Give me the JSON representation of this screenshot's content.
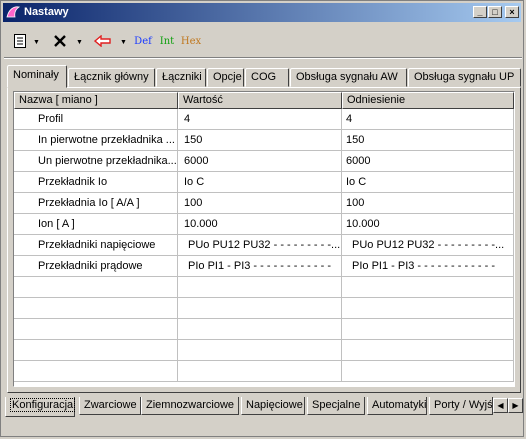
{
  "window": {
    "title": "Nastawy"
  },
  "toolbar": {
    "def_label": "Def",
    "int_label": "Int",
    "hex_label": "Hex"
  },
  "top_tabs": [
    "Nominały",
    "Łącznik główny",
    "Łączniki",
    "Opcje",
    "COG",
    "Obsługa sygnału AW",
    "Obsługa sygnału UP"
  ],
  "table": {
    "headers": [
      "Nazwa [ miano ]",
      "Wartość",
      "Odniesienie"
    ],
    "rows": [
      [
        "Profil",
        "4",
        "4"
      ],
      [
        "In pierwotne przekładnika ...",
        "150",
        "150"
      ],
      [
        "Un pierwotne przekładnika...",
        "6000",
        "6000"
      ],
      [
        "Przekładnik Io",
        "Io C",
        "Io C"
      ],
      [
        "Przekładnia Io  [ A/A ]",
        "100",
        "100"
      ],
      [
        "Ion  [ A ]",
        "10.000",
        "10.000"
      ],
      [
        "Przekładniki napięciowe",
        "PUo PU12 PU32 - - - - - - - - -...",
        "PUo PU12 PU32 - - - - - - - - -..."
      ],
      [
        "Przekładniki prądowe",
        "PIo PI1 - PI3 - - - - - - - - - - - -",
        "PIo PI1 - PI3 - - - - - - - - - - - -"
      ]
    ]
  },
  "bottom_tabs": [
    "Konfiguracja",
    "Zwarciowe",
    "Ziemnozwarciowe",
    "Napięciowe",
    "Specjalne",
    "Automatyki",
    "Porty / Wyjś"
  ],
  "colors": {
    "title_start": "#0a246a",
    "title_end": "#a6caf0",
    "face": "#d4d0c8"
  }
}
